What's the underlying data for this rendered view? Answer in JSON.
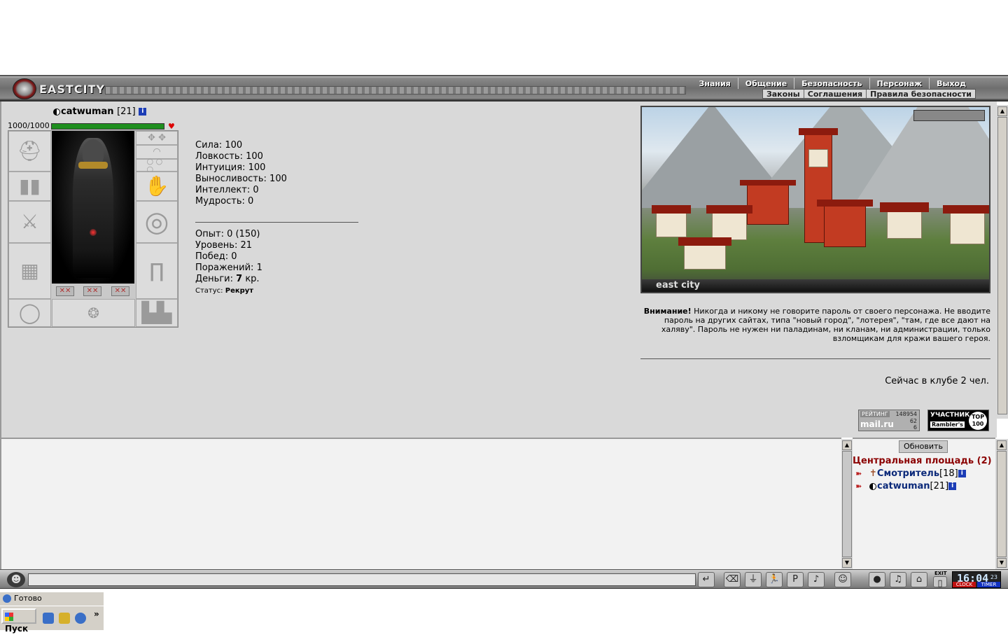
{
  "header": {
    "logo_text": "EASTCITY",
    "nav_main": [
      "Знания",
      "Общение",
      "Безопасность",
      "Персонаж",
      "Выход"
    ],
    "nav_sub": [
      "Законы",
      "Соглашения",
      "Правила безопасности"
    ]
  },
  "character": {
    "name": "catwuman",
    "level": "[21]",
    "hp": "1000/1000",
    "hp_fraction": 1.0,
    "stats": {
      "strength": "Сила: 100",
      "agility": "Ловкость: 100",
      "intuition": "Интуиция: 100",
      "endurance": "Выносливость: 100",
      "intellect": "Интеллект: 0",
      "wisdom": "Мудрость: 0"
    },
    "progress": {
      "experience": "Опыт: 0 (150)",
      "level": "Уровень: 21",
      "wins": "Побед: 0",
      "losses": "Поражений: 1",
      "money_label": "Деньги:",
      "money_value": "7",
      "money_unit": "кр.",
      "status_label": "Статус:",
      "status_value": "Рекрут"
    }
  },
  "town": {
    "label": "east city"
  },
  "warning": {
    "bold": "Внимание!",
    "text": "Никогда и никому не говорите пароль от своего персонажа. Не вводите пароль на других сайтах, типа \"новый город\", \"лотерея\", \"там, где все дают на халяву\". Пароль не нужен ни паладинам, ни кланам, ни администрации, только взломщикам для кражи вашего героя."
  },
  "club_count": "Сейчас в клубе 2 чел.",
  "badges": {
    "mailru": {
      "title": "РЕЙТИНГ",
      "n1": "148954",
      "brand": "mail.ru",
      "n2": "62",
      "n3": "6"
    },
    "rambler": {
      "title": "УЧАСТНИК",
      "brand": "Rambler's",
      "top": "TOP 100"
    }
  },
  "online": {
    "refresh_label": "Обновить",
    "room_title": "Центральная площадь (2)",
    "users": [
      {
        "name": "Смотритель",
        "level": "[18]"
      },
      {
        "name": "catwuman",
        "level": "[21]"
      }
    ]
  },
  "toolbar": {
    "clock_time": "16:04",
    "clock_seconds": "23",
    "clock_label": "CLOCK",
    "timer_label": "TIMER",
    "exit_label": "EXIT"
  },
  "statusbar": {
    "text": "Готово"
  },
  "taskbar": {
    "start_label": "Пуск",
    "more": "»"
  },
  "colors": {
    "hp_bar": "#1f8f1f",
    "room_title": "#8b0000",
    "username": "#0c2a7a",
    "panel_bg": "#d9d9d9"
  }
}
